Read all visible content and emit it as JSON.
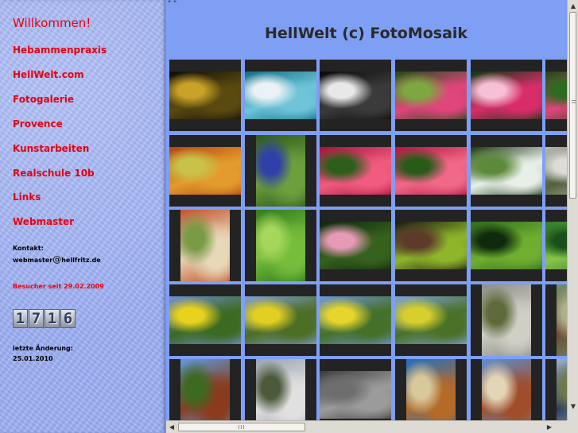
{
  "sidebar": {
    "nav": [
      "Willkommen!",
      "Hebammenpraxis",
      "HellWelt.com",
      "Fotogalerie",
      "Provence",
      "Kunstarbeiten",
      "Realschule 10b",
      "Links",
      "Webmaster"
    ],
    "contact_label": "Kontakt:",
    "contact_user": "webmaster",
    "contact_at": "@",
    "contact_domain": "hellfritz.de",
    "visitors_label": "Besucher seit 29.02.2009",
    "counter_digits": [
      "1",
      "7",
      "1",
      "6"
    ],
    "last_changed_label": "letzte Änderung:",
    "last_changed_date": "25.01.2010"
  },
  "main": {
    "quotes": "\" \"",
    "title": "HellWelt (c) FotoMosaik",
    "tiles": [
      {
        "subject": "golden-bokeh-lights",
        "orientation": "landscape",
        "colors": [
          "#0f0e06",
          "#5a4a10",
          "#c9a227"
        ]
      },
      {
        "subject": "blue-macro-water-pattern",
        "orientation": "landscape",
        "colors": [
          "#0f6e86",
          "#6fc4d8",
          "#e9f2f4"
        ]
      },
      {
        "subject": "water-droplets-bokeh",
        "orientation": "landscape",
        "colors": [
          "#0a0a0a",
          "#3b3b3b",
          "#e8e8e8"
        ]
      },
      {
        "subject": "pink-orchids",
        "orientation": "landscape",
        "colors": [
          "#1f4d17",
          "#e0457c",
          "#7da83f"
        ]
      },
      {
        "subject": "pink-orchid-spray",
        "orientation": "landscape",
        "colors": [
          "#0f3a10",
          "#d92d6a",
          "#f6c0d6"
        ]
      },
      {
        "subject": "pink-orchid-edge",
        "orientation": "landscape",
        "colors": [
          "#1c4a14",
          "#e0457c",
          "#2d6b1e"
        ]
      },
      {
        "subject": "colorful-textile-stripes",
        "orientation": "landscape",
        "colors": [
          "#b44412",
          "#e39c2c",
          "#c8c24a"
        ]
      },
      {
        "subject": "blue-flower-stem",
        "orientation": "portrait",
        "colors": [
          "#2d5a1d",
          "#6e9f3d",
          "#3140a8"
        ]
      },
      {
        "subject": "pink-lily-closeup",
        "orientation": "landscape",
        "colors": [
          "#a6123a",
          "#f05b7f",
          "#2d5e1c"
        ]
      },
      {
        "subject": "pink-lily-closeup-2",
        "orientation": "landscape",
        "colors": [
          "#b0153e",
          "#f26888",
          "#2a5a1a"
        ]
      },
      {
        "subject": "white-flower-bush",
        "orientation": "landscape",
        "colors": [
          "#1e3a12",
          "#e8efe8",
          "#5d8a3a"
        ]
      },
      {
        "subject": "stone-path-edge",
        "orientation": "landscape",
        "colors": [
          "#b7b7b0",
          "#53613e",
          "#dcdcd6"
        ]
      },
      {
        "subject": "striped-curtain-fabric",
        "orientation": "portrait",
        "colors": [
          "#c4532d",
          "#e6d8b8",
          "#7a9b45"
        ]
      },
      {
        "subject": "green-leaf-veins",
        "orientation": "portrait",
        "colors": [
          "#2f7c1d",
          "#77bd3c",
          "#a6d65c"
        ]
      },
      {
        "subject": "pink-stem-dark-leaves",
        "orientation": "landscape",
        "colors": [
          "#10260f",
          "#36611e",
          "#e79ab6"
        ]
      },
      {
        "subject": "dark-veined-leaf",
        "orientation": "landscape",
        "colors": [
          "#1a1a12",
          "#8fb52a",
          "#5d3a2a"
        ]
      },
      {
        "subject": "fern-frond-curl",
        "orientation": "landscape",
        "colors": [
          "#2c6b1c",
          "#6fae30",
          "#0f2a0c"
        ]
      },
      {
        "subject": "green-fronds-edge",
        "orientation": "landscape",
        "colors": [
          "#2c7a2a",
          "#89c44a",
          "#185018"
        ]
      },
      {
        "subject": "olive-grove-yellow-flowers",
        "orientation": "landscape",
        "colors": [
          "#6f8fd6",
          "#3d6a22",
          "#e8d21e"
        ]
      },
      {
        "subject": "olive-grove-sunny",
        "orientation": "landscape",
        "colors": [
          "#7ea0d9",
          "#4d6e25",
          "#e2cf22"
        ]
      },
      {
        "subject": "olive-tree-meadow",
        "orientation": "landscape",
        "colors": [
          "#6f98db",
          "#45702a",
          "#e5d52c"
        ]
      },
      {
        "subject": "olive-tree-meadow-2",
        "orientation": "landscape",
        "colors": [
          "#7fa5de",
          "#4a7128",
          "#d8cf2e"
        ]
      },
      {
        "subject": "bare-trees-path",
        "orientation": "portrait",
        "colors": [
          "#8e8f86",
          "#cfcfc6",
          "#5e6a3a"
        ]
      },
      {
        "subject": "olive-tree-edge",
        "orientation": "portrait",
        "colors": [
          "#6f8f6f",
          "#6b4a2e",
          "#b0b08a"
        ]
      },
      {
        "subject": "water-tower-brick-blue-sky",
        "orientation": "portrait",
        "colors": [
          "#5d9bd9",
          "#8a3b1e",
          "#3d6a20"
        ]
      },
      {
        "subject": "white-tower-grey-sky",
        "orientation": "portrait",
        "colors": [
          "#9aa4b0",
          "#e0e0e0",
          "#4a5a3a"
        ]
      },
      {
        "subject": "cobblestone-pavement",
        "orientation": "landscape",
        "colors": [
          "#3c3c3c",
          "#9b9b9b",
          "#6e6e6e"
        ]
      },
      {
        "subject": "water-tower-sunset",
        "orientation": "portrait",
        "colors": [
          "#1f6fc2",
          "#b46a28",
          "#d9c89a"
        ]
      },
      {
        "subject": "water-tower-brick-2",
        "orientation": "portrait",
        "colors": [
          "#5c8fcf",
          "#a04e2a",
          "#e3d5b6"
        ]
      },
      {
        "subject": "walker-path-edge",
        "orientation": "portrait",
        "colors": [
          "#9bb1c8",
          "#2c3c5a",
          "#6e7a4a"
        ]
      }
    ]
  },
  "scrollbars": {
    "up_arrow": "▲",
    "down_arrow": "▼",
    "left_arrow": "◀",
    "right_arrow": "▶"
  }
}
